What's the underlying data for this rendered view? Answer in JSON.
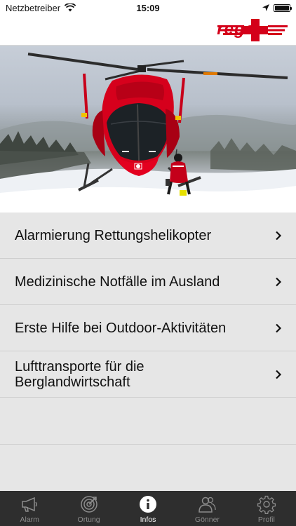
{
  "status_bar": {
    "carrier": "Netzbetreiber",
    "time": "15:09"
  },
  "header": {
    "logo_text": "rega",
    "brand_color": "#d4001a"
  },
  "list": {
    "items": [
      {
        "label": "Alarmierung Rettungshelikopter"
      },
      {
        "label": "Medizinische Notfälle im Ausland"
      },
      {
        "label": "Erste Hilfe bei Outdoor-Aktivitäten"
      },
      {
        "label": "Lufttransporte für die Berglandwirtschaft"
      }
    ]
  },
  "tabbar": {
    "tabs": [
      {
        "label": "Alarm",
        "icon": "megaphone-icon"
      },
      {
        "label": "Ortung",
        "icon": "radar-icon"
      },
      {
        "label": "Infos",
        "icon": "info-icon",
        "active": true
      },
      {
        "label": "Gönner",
        "icon": "people-icon"
      },
      {
        "label": "Profil",
        "icon": "gear-icon"
      }
    ]
  }
}
